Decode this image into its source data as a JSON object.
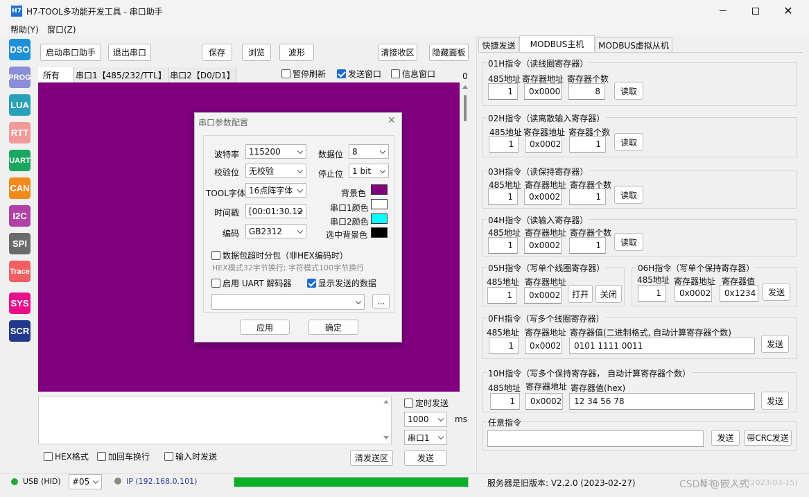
{
  "window": {
    "icon_text": "H7",
    "title": "H7-TOOL多功能开发工具 - 串口助手"
  },
  "menu": [
    "帮助(Y)",
    "窗口(Z)"
  ],
  "sidebar": [
    {
      "label": "DSO",
      "color": "#1e90d8"
    },
    {
      "label": "PROG",
      "color": "#8b8fd8"
    },
    {
      "label": "LUA",
      "color": "#27a0b8"
    },
    {
      "label": "RTT",
      "color": "#f29a9a"
    },
    {
      "label": "UART",
      "color": "#1aa860"
    },
    {
      "label": "CAN",
      "color": "#f28a1a"
    },
    {
      "label": "I2C",
      "color": "#b042a8"
    },
    {
      "label": "SPI",
      "color": "#6b6b6b"
    },
    {
      "label": "Trace",
      "color": "#f06060"
    },
    {
      "label": "SYS",
      "color": "#e8108a"
    },
    {
      "label": "SCR",
      "color": "#213a8c"
    }
  ],
  "toolbar": {
    "start": "启动串口助手",
    "exit": "退出串口",
    "save": "保存",
    "browse": "浏览",
    "wave": "波形",
    "clear_rx": "清接收区",
    "hide_panel": "隐藏面板"
  },
  "rx_tabs": [
    "所有",
    "串口1【485/232/TTL】",
    "串口2【D0/D1】"
  ],
  "rx_options": {
    "pause": "暂停刷新",
    "send_window": "发送窗口",
    "info_window": "信息窗口",
    "count": "0"
  },
  "dialog": {
    "title": "串口参数配置",
    "baud_label": "波特率",
    "baud": "115200",
    "databits_label": "数据位",
    "databits": "8",
    "parity_label": "校验位",
    "parity": "无校验",
    "stopbits_label": "停止位",
    "stopbits": "1 bit",
    "font_label": "TOOL字体",
    "font": "16点阵字体",
    "timestamp_label": "时间戳",
    "timestamp": "[00:01:30.12",
    "encoding_label": "编码",
    "encoding": "GB2312",
    "bg_label": "背景色",
    "uart1_color_label": "串口1颜色",
    "uart2_color_label": "串口2颜色",
    "sel_bg_label": "选中背景色",
    "bg_color": "#800080",
    "uart1_color": "#ffffff",
    "uart2_color": "#00ffff",
    "sel_bg_color": "#000000",
    "packet_split": "数据包超时分包（非HEX编码时）",
    "packet_note": "HEX模式32字节换行; 字符模式100字节换行",
    "uart_decoder": "启用 UART 解码器",
    "show_sent": "显示发送的数据",
    "browse_btn": "...",
    "apply": "应用",
    "ok": "确定"
  },
  "send": {
    "timed_send": "定时发送",
    "interval": "1000",
    "unit": "ms",
    "port": "串口1",
    "hex": "HEX格式",
    "add_crlf": "加回车换行",
    "send_on_input": "输入时发送",
    "clear_tx": "清发送区",
    "send": "发送"
  },
  "right_tabs": [
    "快捷发送",
    "MODBUS主机",
    "MODBUS虚拟从机"
  ],
  "modbus": {
    "col_addr": "485地址",
    "col_reg": "寄存器地址",
    "col_count": "寄存器个数",
    "col_value": "寄存器值",
    "read": "读取",
    "send": "发送",
    "open": "打开",
    "close": "关闭",
    "g01": {
      "title": "01H指令（读线圈寄存器）",
      "addr": "1",
      "reg": "0x0000",
      "count": "8"
    },
    "g02": {
      "title": "02H指令（读离散输入寄存器）",
      "addr": "1",
      "reg": "0x0002",
      "count": "1"
    },
    "g03": {
      "title": "03H指令（读保持寄存器）",
      "addr": "1",
      "reg": "0x0002",
      "count": "1"
    },
    "g04": {
      "title": "04H指令（读输入寄存器）",
      "addr": "1",
      "reg": "0x0002",
      "count": "1"
    },
    "g05": {
      "title": "05H指令（写单个线圈寄存器）",
      "addr": "1",
      "reg": "0x0002"
    },
    "g06": {
      "title": "06H指令（写单个保持寄存器）",
      "addr": "1",
      "reg": "0x0002",
      "value": "0x1234"
    },
    "g0f": {
      "title": "0FH指令（写多个线圈寄存器）",
      "value_label": "寄存器值(二进制格式, 自动计算寄存器个数)",
      "addr": "1",
      "reg": "0x0002",
      "value": "0101 1111 0011"
    },
    "g10": {
      "title": "10H指令（写多个保持寄存器，  自动计算寄存器个数）",
      "value_label": "寄存器值(hex)",
      "addr": "1",
      "reg": "0x0002",
      "value": "12 34 56 78"
    },
    "gany": {
      "title": "任意指令",
      "crc_send": "带CRC发送"
    }
  },
  "status": {
    "usb": "USB (HID)",
    "device": "#05",
    "ip": "IP (192.168.0.101)",
    "progress": 100,
    "server_version": "服务器是旧版本: V2.2.0 (2023-02-27)",
    "local_version": "版本: V2.2.0 (2023-03-15)",
    "watermark": "CSDN @嵌入式"
  }
}
